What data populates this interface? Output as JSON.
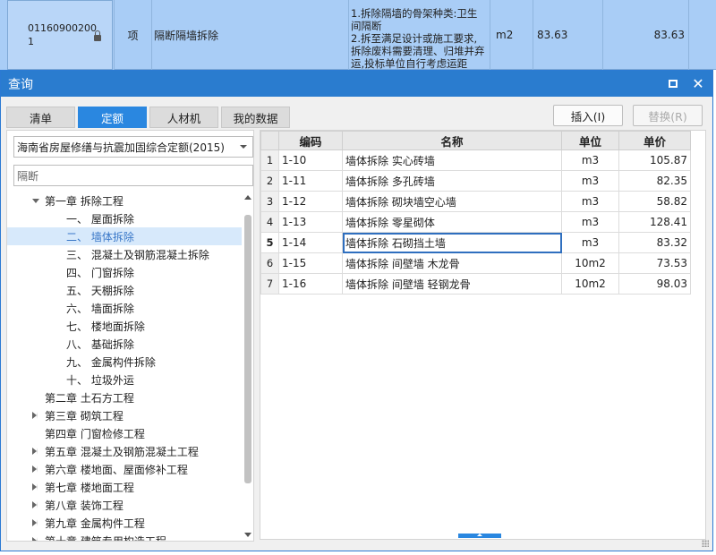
{
  "background_row": {
    "code_line1": "01160900200",
    "code_line2": "1",
    "type": "项",
    "name": "隔断隔墙拆除",
    "desc_lines": [
      "1.拆除隔墙的骨架种类:卫生",
      "间隔断",
      "2.拆至满足设计或施工要求,",
      "拆除废料需要清理、归堆并弃",
      "运,投标单位自行考虑运距"
    ],
    "unit": "m2",
    "quantity": "83.63",
    "price": "83.63"
  },
  "dialog": {
    "title": "查询",
    "tabs": [
      "清单",
      "定额",
      "人材机",
      "我的数据"
    ],
    "active_tab": "定额",
    "insert_label": "插入(I)",
    "replace_label": "替换(R)",
    "quota_book": "海南省房屋修缮与抗震加固综合定额(2015)",
    "search_value": "隔断",
    "tree": [
      {
        "label": "第一章 拆除工程",
        "level": 1,
        "expander": "down"
      },
      {
        "label": "一、 屋面拆除",
        "level": 2
      },
      {
        "label": "二、 墙体拆除",
        "level": 2,
        "selected": true
      },
      {
        "label": "三、 混凝土及钢筋混凝土拆除",
        "level": 2
      },
      {
        "label": "四、 门窗拆除",
        "level": 2
      },
      {
        "label": "五、 天棚拆除",
        "level": 2
      },
      {
        "label": "六、 墙面拆除",
        "level": 2
      },
      {
        "label": "七、 楼地面拆除",
        "level": 2
      },
      {
        "label": "八、 基础拆除",
        "level": 2
      },
      {
        "label": "九、 金属构件拆除",
        "level": 2
      },
      {
        "label": "十、 垃圾外运",
        "level": 2
      },
      {
        "label": "第二章 土石方工程",
        "level": 0
      },
      {
        "label": "第三章 砌筑工程",
        "level": 0,
        "expander": "right"
      },
      {
        "label": "第四章 门窗检修工程",
        "level": 0
      },
      {
        "label": "第五章 混凝土及钢筋混凝土工程",
        "level": 0,
        "expander": "right"
      },
      {
        "label": "第六章 楼地面、屋面修补工程",
        "level": 0,
        "expander": "right"
      },
      {
        "label": "第七章 楼地面工程",
        "level": 0,
        "expander": "right"
      },
      {
        "label": "第八章 装饰工程",
        "level": 0,
        "expander": "right"
      },
      {
        "label": "第九章 金属构件工程",
        "level": 0,
        "expander": "right"
      },
      {
        "label": "第十章 建筑专用构造工程",
        "level": 0,
        "expander": "right"
      }
    ],
    "table": {
      "headers": [
        "编码",
        "名称",
        "单位",
        "单价"
      ],
      "current_row": 5,
      "rows": [
        [
          "1",
          "1-10",
          "墙体拆除 实心砖墙",
          "m3",
          "105.87"
        ],
        [
          "2",
          "1-11",
          "墙体拆除 多孔砖墙",
          "m3",
          "82.35"
        ],
        [
          "3",
          "1-12",
          "墙体拆除 砌块墙空心墙",
          "m3",
          "58.82"
        ],
        [
          "4",
          "1-13",
          "墙体拆除 零星砌体",
          "m3",
          "128.41"
        ],
        [
          "5",
          "1-14",
          "墙体拆除 石砌挡土墙",
          "m3",
          "83.32"
        ],
        [
          "6",
          "1-15",
          "墙体拆除 间壁墙 木龙骨",
          "10m2",
          "73.53"
        ],
        [
          "7",
          "1-16",
          "墙体拆除 间壁墙 轻钢龙骨",
          "10m2",
          "98.03"
        ]
      ]
    }
  }
}
